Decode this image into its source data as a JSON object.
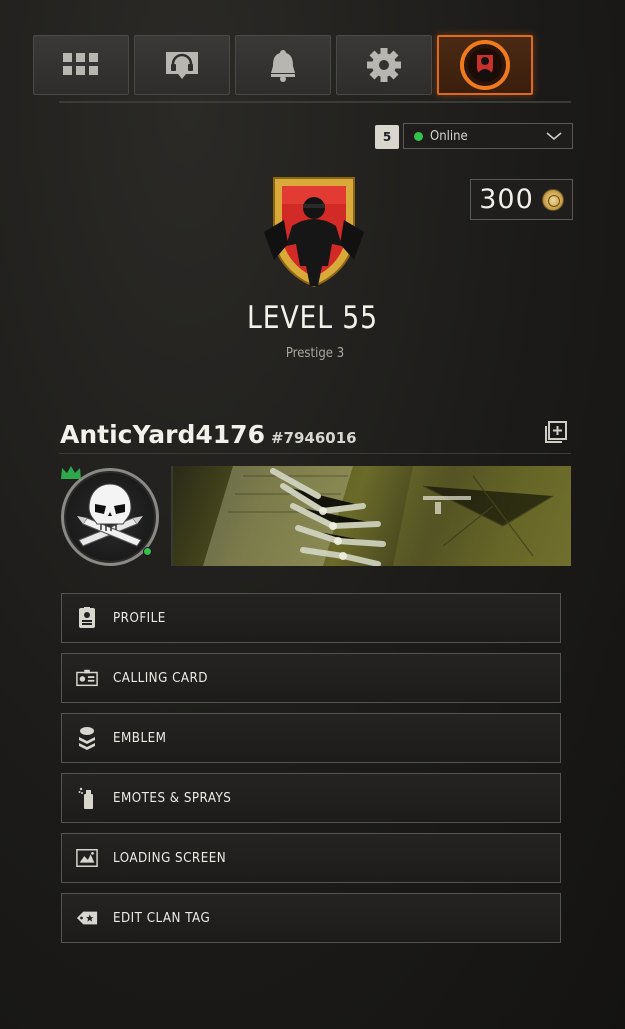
{
  "nav": {
    "tabs": [
      {
        "icon": "grid-icon",
        "active": false
      },
      {
        "icon": "headset-icon",
        "active": false
      },
      {
        "icon": "bell-icon",
        "active": false
      },
      {
        "icon": "gear-icon",
        "active": false
      },
      {
        "icon": "player-emblem-icon",
        "active": true
      }
    ],
    "accent_color": "#e06a1c"
  },
  "status": {
    "party_count": "5",
    "selected": "Online",
    "online_color": "#33c24a"
  },
  "currency": {
    "amount": "300",
    "icon": "cod-point-coin-icon"
  },
  "progression": {
    "level_text": "LEVEL 55",
    "prestige_text": "Prestige 3",
    "emblem": "prestige-3-emblem-icon"
  },
  "player": {
    "name": "AnticYard4176",
    "tag": "#7946016",
    "avatar": "skull-bullets-avatar",
    "online": true
  },
  "menu": {
    "items": [
      {
        "label": "PROFILE",
        "icon": "profile-card-icon"
      },
      {
        "label": "CALLING CARD",
        "icon": "calling-card-icon"
      },
      {
        "label": "EMBLEM",
        "icon": "emblem-chevrons-icon"
      },
      {
        "label": "EMOTES & SPRAYS",
        "icon": "spray-can-icon"
      },
      {
        "label": "LOADING SCREEN",
        "icon": "loading-screen-icon"
      },
      {
        "label": "EDIT CLAN TAG",
        "icon": "clan-tag-icon"
      }
    ]
  }
}
